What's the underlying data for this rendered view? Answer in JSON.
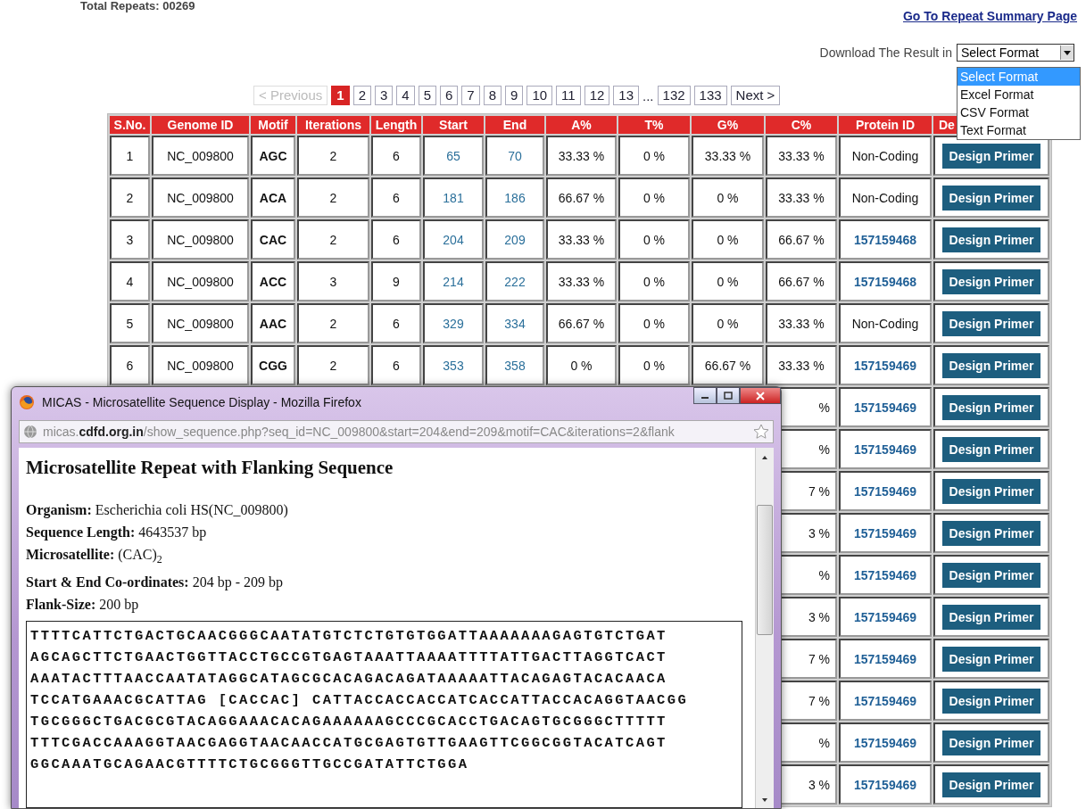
{
  "header": {
    "total_repeats": "Total Repeats: 00269",
    "summary_link": "Go To Repeat Summary Page"
  },
  "download": {
    "label": "Download The Result in",
    "value": "Select Format",
    "options": [
      {
        "label": "Select Format",
        "selected": true
      },
      {
        "label": "Excel Format",
        "selected": false
      },
      {
        "label": "CSV Format",
        "selected": false
      },
      {
        "label": "Text Format",
        "selected": false
      }
    ]
  },
  "pagination": {
    "previous": {
      "label": "< Previous",
      "disabled": true
    },
    "pages": [
      {
        "label": "1",
        "selected": true
      },
      {
        "label": "2",
        "selected": false
      },
      {
        "label": "3",
        "selected": false
      },
      {
        "label": "4",
        "selected": false
      },
      {
        "label": "5",
        "selected": false
      },
      {
        "label": "6",
        "selected": false
      },
      {
        "label": "7",
        "selected": false
      },
      {
        "label": "8",
        "selected": false
      },
      {
        "label": "9",
        "selected": false
      },
      {
        "label": "10",
        "selected": false
      },
      {
        "label": "11",
        "selected": false
      },
      {
        "label": "12",
        "selected": false
      },
      {
        "label": "13",
        "selected": false
      }
    ],
    "ellipsis": "...",
    "last_pages": [
      {
        "label": "132",
        "selected": false
      },
      {
        "label": "133",
        "selected": false
      }
    ],
    "next": {
      "label": "Next >",
      "disabled": false
    }
  },
  "table": {
    "columns": [
      "S.No.",
      "Genome ID",
      "Motif",
      "Iterations",
      "Length",
      "Start",
      "End",
      "A%",
      "T%",
      "G%",
      "C%",
      "Protein ID",
      "De"
    ],
    "rows": [
      {
        "kind": "full",
        "sno": "1",
        "genome_id": "NC_009800",
        "motif": "AGC",
        "iterations": "2",
        "length": "6",
        "start": "65",
        "end": "70",
        "a_pct": "33.33 %",
        "t_pct": "0 %",
        "g_pct": "33.33 %",
        "c_pct": "33.33 %",
        "protein_id": {
          "text": "Non-Coding",
          "linked": false
        },
        "action": "Design Primer"
      },
      {
        "kind": "full",
        "sno": "2",
        "genome_id": "NC_009800",
        "motif": "ACA",
        "iterations": "2",
        "length": "6",
        "start": "181",
        "end": "186",
        "a_pct": "66.67 %",
        "t_pct": "0 %",
        "g_pct": "0 %",
        "c_pct": "33.33 %",
        "protein_id": {
          "text": "Non-Coding",
          "linked": false
        },
        "action": "Design Primer"
      },
      {
        "kind": "full",
        "sno": "3",
        "genome_id": "NC_009800",
        "motif": "CAC",
        "iterations": "2",
        "length": "6",
        "start": "204",
        "end": "209",
        "a_pct": "33.33 %",
        "t_pct": "0 %",
        "g_pct": "0 %",
        "c_pct": "66.67 %",
        "protein_id": {
          "text": "157159468",
          "linked": true
        },
        "action": "Design Primer"
      },
      {
        "kind": "full",
        "sno": "4",
        "genome_id": "NC_009800",
        "motif": "ACC",
        "iterations": "3",
        "length": "9",
        "start": "214",
        "end": "222",
        "a_pct": "33.33 %",
        "t_pct": "0 %",
        "g_pct": "0 %",
        "c_pct": "66.67 %",
        "protein_id": {
          "text": "157159468",
          "linked": true
        },
        "action": "Design Primer"
      },
      {
        "kind": "full",
        "sno": "5",
        "genome_id": "NC_009800",
        "motif": "AAC",
        "iterations": "2",
        "length": "6",
        "start": "329",
        "end": "334",
        "a_pct": "66.67 %",
        "t_pct": "0 %",
        "g_pct": "0 %",
        "c_pct": "33.33 %",
        "protein_id": {
          "text": "Non-Coding",
          "linked": false
        },
        "action": "Design Primer"
      },
      {
        "kind": "full",
        "sno": "6",
        "genome_id": "NC_009800",
        "motif": "CGG",
        "iterations": "2",
        "length": "6",
        "start": "353",
        "end": "358",
        "a_pct": "0 %",
        "t_pct": "0 %",
        "g_pct": "66.67 %",
        "c_pct": "33.33 %",
        "protein_id": {
          "text": "157159469",
          "linked": true
        },
        "action": "Design Primer"
      },
      {
        "kind": "covered",
        "c_pct": "%",
        "protein_id": {
          "text": "157159469",
          "linked": true
        },
        "action": "Design Primer"
      },
      {
        "kind": "covered",
        "c_pct": "%",
        "protein_id": {
          "text": "157159469",
          "linked": true
        },
        "action": "Design Primer"
      },
      {
        "kind": "covered",
        "c_pct": "7 %",
        "protein_id": {
          "text": "157159469",
          "linked": true
        },
        "action": "Design Primer"
      },
      {
        "kind": "covered",
        "c_pct": "3 %",
        "protein_id": {
          "text": "157159469",
          "linked": true
        },
        "action": "Design Primer"
      },
      {
        "kind": "covered",
        "c_pct": "%",
        "protein_id": {
          "text": "157159469",
          "linked": true
        },
        "action": "Design Primer"
      },
      {
        "kind": "covered",
        "c_pct": "3 %",
        "protein_id": {
          "text": "157159469",
          "linked": true
        },
        "action": "Design Primer"
      },
      {
        "kind": "covered",
        "c_pct": "7 %",
        "protein_id": {
          "text": "157159469",
          "linked": true
        },
        "action": "Design Primer"
      },
      {
        "kind": "covered",
        "c_pct": "7 %",
        "protein_id": {
          "text": "157159469",
          "linked": true
        },
        "action": "Design Primer"
      },
      {
        "kind": "covered",
        "c_pct": "%",
        "protein_id": {
          "text": "157159469",
          "linked": true
        },
        "action": "Design Primer"
      },
      {
        "kind": "covered",
        "c_pct": "3 %",
        "protein_id": {
          "text": "157159469",
          "linked": true
        },
        "action": "Design Primer"
      }
    ]
  },
  "popup": {
    "title": "MICAS - Microsatellite Sequence Display - Mozilla Firefox",
    "url": "micas.**cdfd.org.in**/show_sequence.php?seq_id=NC_009800&start=204&end=209&motif=CAC&iterations=2&flank",
    "heading": "Microsatellite Repeat with Flanking Sequence",
    "fields": [
      "**Organism:** Escherichia coli HS(NC_009800)",
      "**Sequence Length:** 4643537 bp",
      "**Microsatellite:** (CAC)$_{2}$",
      "**Start & End Co-ordinates:** 204 bp - 209 bp",
      "**Flank-Size:** 200 bp"
    ],
    "sequence": [
      "TTTTCATTCTGACTGCAACGGGCAATATGTCTCTGTGTGGATTAAAAAAAGAGTGTCTGAT",
      "AGCAGCTTCTGAACTGGTTACCTGCCGTGAGTAAATTAAAATTTTATTGACTTAGGTCACT",
      "AAATACTTTAACCAATATAGGCATAGCGCACAGACAGATAAAAATTACAGAGTACACAACA",
      "TCCATGAAACGCATTAG [CACCAC] CATTACCACCACCATCACCATTACCACAGGTAACGG",
      "TGCGGGCTGACGCGTACAGGAAACACAGAAAAAAGCCCGCACCTGACAGTGCGGGCTTTTT",
      "TTTCGACCAAAGGTAACGAGGTAACAACCATGCGAGTGTTGAAGTTCGGCGGTACATCAGT",
      "GGCAAATGCAGAACGTTTTCTGCGGGTTGCCGATATTCTGGA"
    ]
  }
}
